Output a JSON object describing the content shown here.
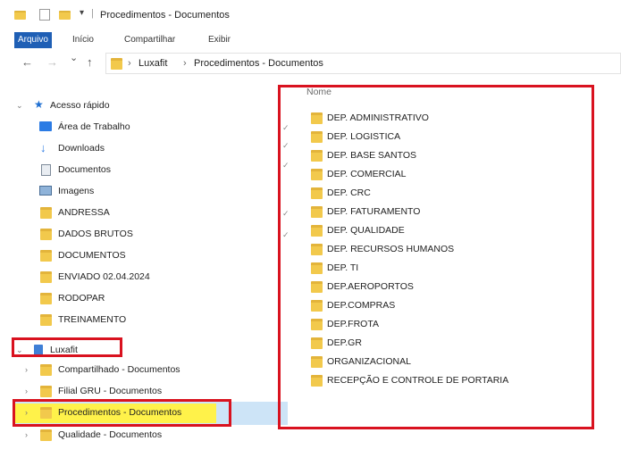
{
  "window": {
    "title": "Procedimentos - Documentos",
    "qa_separator": "|",
    "qa_dropdown": "▾"
  },
  "ribbon": {
    "tabs": [
      {
        "label": "Arquivo",
        "active": true
      },
      {
        "label": "Início",
        "active": false
      },
      {
        "label": "Compartilhar",
        "active": false
      },
      {
        "label": "Exibir",
        "active": false
      }
    ]
  },
  "nav": {
    "back": "←",
    "forward": "→",
    "recent": "⌄",
    "up": "↑",
    "breadcrumb": [
      "Luxafit",
      "Procedimentos - Documentos"
    ],
    "separator": "›"
  },
  "sidebar": {
    "quick_access_label": "Acesso rápido",
    "quick_items": [
      {
        "label": "Área de Trabalho",
        "icon": "desktop-icon"
      },
      {
        "label": "Downloads",
        "icon": "download-icon"
      },
      {
        "label": "Documentos",
        "icon": "documents-icon"
      },
      {
        "label": "Imagens",
        "icon": "images-icon"
      },
      {
        "label": "ANDRESSA",
        "icon": "folder-icon"
      },
      {
        "label": "DADOS BRUTOS",
        "icon": "folder-icon"
      },
      {
        "label": "DOCUMENTOS",
        "icon": "folder-icon"
      },
      {
        "label": "ENVIADO 02.04.2024",
        "icon": "folder-icon"
      },
      {
        "label": "RODOPAR",
        "icon": "folder-icon"
      },
      {
        "label": "TREINAMENTO",
        "icon": "folder-icon"
      }
    ],
    "org_label": "Luxafit",
    "org_items": [
      {
        "label": "Compartilhado - Documentos",
        "selected": false
      },
      {
        "label": "Filial GRU - Documentos",
        "selected": false
      },
      {
        "label": "Procedimentos - Documentos",
        "selected": true
      },
      {
        "label": "Qualidade - Documentos",
        "selected": false
      }
    ]
  },
  "content": {
    "column_name": "Nome",
    "folders": [
      "DEP.  ADMINISTRATIVO",
      "DEP.  LOGISTICA",
      "DEP. BASE SANTOS",
      "DEP. COMERCIAL",
      "DEP. CRC",
      "DEP. FATURAMENTO",
      "DEP. QUALIDADE",
      "DEP. RECURSOS HUMANOS",
      "DEP. TI",
      "DEP.AEROPORTOS",
      "DEP.COMPRAS",
      "DEP.FROTA",
      "DEP.GR",
      "ORGANIZACIONAL",
      "RECEPÇÃO E CONTROLE DE PORTARIA"
    ]
  },
  "colors": {
    "accent": "#1f5fb5",
    "annotation_red": "#d9121f",
    "highlight_yellow": "#fff24a",
    "folder_yellow": "#f2c94c",
    "selection_blue": "#cde4f7"
  }
}
